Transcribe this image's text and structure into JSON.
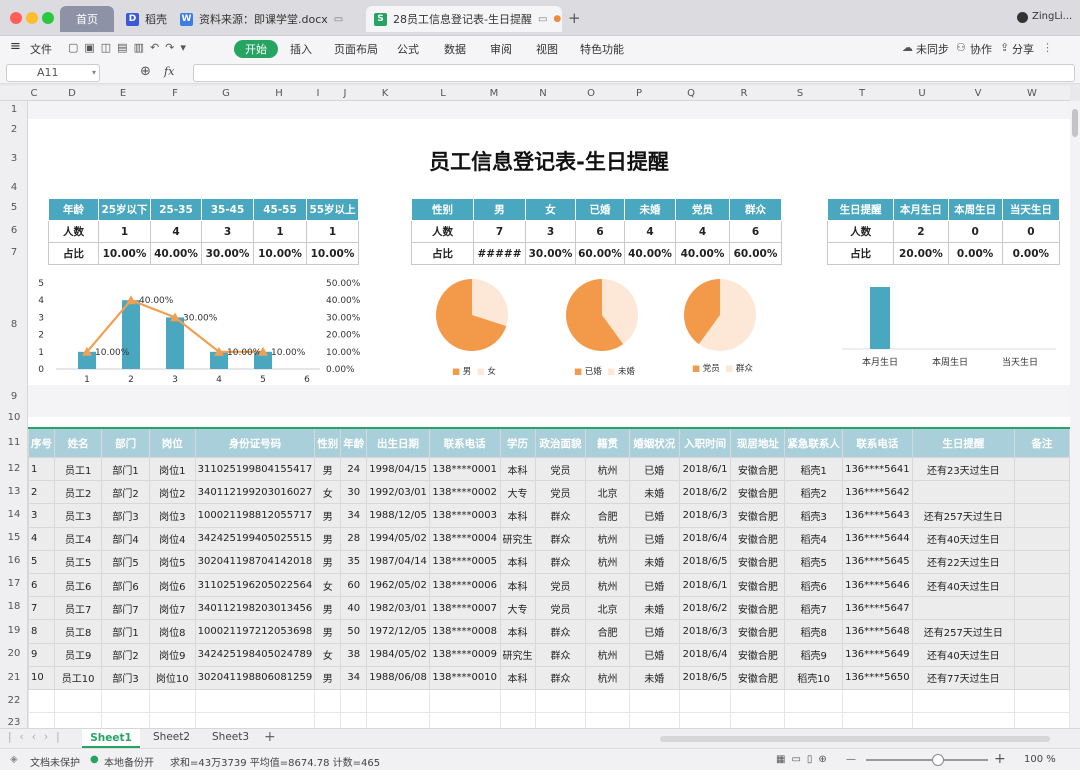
{
  "window": {
    "tabs": [
      {
        "label": "首页"
      },
      {
        "label": "稻壳",
        "icon": "daoke-icon"
      },
      {
        "label": "资料来源：即课学堂.docx",
        "icon": "word-doc-icon"
      },
      {
        "label": "28员工信息登记表-生日提醒",
        "icon": "sheet-doc-icon"
      }
    ],
    "user": "ZingLi..."
  },
  "toolbar": {
    "file": "文件",
    "menus": [
      "开始",
      "插入",
      "页面布局",
      "公式",
      "数据",
      "审阅",
      "视图",
      "特色功能"
    ],
    "sync": "未同步",
    "collab": "协作",
    "share": "分享"
  },
  "formula": {
    "cell_ref": "A11",
    "fx": "fx",
    "value": ""
  },
  "columns": [
    "C",
    "D",
    "E",
    "F",
    "G",
    "H",
    "I",
    "J",
    "K",
    "L",
    "M",
    "N",
    "O",
    "P",
    "Q",
    "R",
    "S",
    "T",
    "U",
    "V",
    "W"
  ],
  "rows": [
    "1",
    "2",
    "3",
    "4",
    "5",
    "6",
    "7",
    "8",
    "9",
    "10",
    "11",
    "12",
    "13",
    "14",
    "15",
    "16",
    "17",
    "18",
    "19",
    "20",
    "21",
    "22",
    "23"
  ],
  "sheet": {
    "title": "员工信息登记表-生日提醒",
    "age": {
      "headers": [
        "年龄",
        "25岁以下",
        "25-35",
        "35-45",
        "45-55",
        "55岁以上"
      ],
      "count": [
        "人数",
        "1",
        "4",
        "3",
        "1",
        "1"
      ],
      "ratio": [
        "占比",
        "10.00%",
        "40.00%",
        "30.00%",
        "10.00%",
        "10.00%"
      ]
    },
    "gender": {
      "headers": [
        "性别",
        "男",
        "女",
        "已婚",
        "未婚",
        "党员",
        "群众"
      ],
      "count": [
        "人数",
        "7",
        "3",
        "6",
        "4",
        "4",
        "6"
      ],
      "ratio": [
        "占比",
        "#####",
        "30.00%",
        "60.00%",
        "40.00%",
        "40.00%",
        "60.00%"
      ]
    },
    "birthday": {
      "headers": [
        "生日提醒",
        "本月生日",
        "本周生日",
        "当天生日"
      ],
      "count": [
        "人数",
        "2",
        "0",
        "0"
      ],
      "ratio": [
        "占比",
        "20.00%",
        "0.00%",
        "0.00%"
      ]
    },
    "employees": {
      "headers": [
        "序号",
        "姓名",
        "部门",
        "岗位",
        "身份证号码",
        "性别",
        "年龄",
        "出生日期",
        "联系电话",
        "学历",
        "政治面貌",
        "籍贯",
        "婚姻状况",
        "入职时间",
        "现居地址",
        "紧急联系人",
        "联系电话",
        "生日提醒",
        "备注"
      ],
      "rows": [
        [
          "1",
          "员工1",
          "部门1",
          "岗位1",
          "311025199804155417",
          "男",
          "24",
          "1998/04/15",
          "138****0001",
          "本科",
          "党员",
          "杭州",
          "已婚",
          "2018/6/1",
          "安徽合肥",
          "稻壳1",
          "136****5641",
          "还有23天过生日",
          ""
        ],
        [
          "2",
          "员工2",
          "部门2",
          "岗位2",
          "340112199203016027",
          "女",
          "30",
          "1992/03/01",
          "138****0002",
          "大专",
          "党员",
          "北京",
          "未婚",
          "2018/6/2",
          "安徽合肥",
          "稻壳2",
          "136****5642",
          "",
          ""
        ],
        [
          "3",
          "员工3",
          "部门3",
          "岗位3",
          "100021198812055717",
          "男",
          "34",
          "1988/12/05",
          "138****0003",
          "本科",
          "群众",
          "合肥",
          "已婚",
          "2018/6/3",
          "安徽合肥",
          "稻壳3",
          "136****5643",
          "还有257天过生日",
          ""
        ],
        [
          "4",
          "员工4",
          "部门4",
          "岗位4",
          "342425199405025515",
          "男",
          "28",
          "1994/05/02",
          "138****0004",
          "研究生",
          "群众",
          "杭州",
          "已婚",
          "2018/6/4",
          "安徽合肥",
          "稻壳4",
          "136****5644",
          "还有40天过生日",
          ""
        ],
        [
          "5",
          "员工5",
          "部门5",
          "岗位5",
          "302041198704142018",
          "男",
          "35",
          "1987/04/14",
          "138****0005",
          "本科",
          "群众",
          "杭州",
          "未婚",
          "2018/6/5",
          "安徽合肥",
          "稻壳5",
          "136****5645",
          "还有22天过生日",
          ""
        ],
        [
          "6",
          "员工6",
          "部门6",
          "岗位6",
          "311025196205022564",
          "女",
          "60",
          "1962/05/02",
          "138****0006",
          "本科",
          "党员",
          "杭州",
          "已婚",
          "2018/6/1",
          "安徽合肥",
          "稻壳6",
          "136****5646",
          "还有40天过生日",
          ""
        ],
        [
          "7",
          "员工7",
          "部门7",
          "岗位7",
          "340112198203013456",
          "男",
          "40",
          "1982/03/01",
          "138****0007",
          "大专",
          "党员",
          "北京",
          "未婚",
          "2018/6/2",
          "安徽合肥",
          "稻壳7",
          "136****5647",
          "",
          ""
        ],
        [
          "8",
          "员工8",
          "部门1",
          "岗位8",
          "100021197212053698",
          "男",
          "50",
          "1972/12/05",
          "138****0008",
          "本科",
          "群众",
          "合肥",
          "已婚",
          "2018/6/3",
          "安徽合肥",
          "稻壳8",
          "136****5648",
          "还有257天过生日",
          ""
        ],
        [
          "9",
          "员工9",
          "部门2",
          "岗位9",
          "342425198405024789",
          "女",
          "38",
          "1984/05/02",
          "138****0009",
          "研究生",
          "群众",
          "杭州",
          "已婚",
          "2018/6/4",
          "安徽合肥",
          "稻壳9",
          "136****5649",
          "还有40天过生日",
          ""
        ],
        [
          "10",
          "员工10",
          "部门3",
          "岗位10",
          "302041198806081259",
          "男",
          "34",
          "1988/06/08",
          "138****0010",
          "本科",
          "群众",
          "杭州",
          "未婚",
          "2018/6/5",
          "安徽合肥",
          "稻壳10",
          "136****5650",
          "还有77天过生日",
          ""
        ]
      ]
    }
  },
  "chart_data": [
    {
      "type": "bar",
      "categories": [
        "1",
        "2",
        "3",
        "4",
        "5",
        "6"
      ],
      "series": [
        {
          "values": [
            1,
            4,
            3,
            1,
            1
          ]
        },
        {
          "type": "line",
          "values": [
            10,
            40,
            30,
            10,
            10
          ],
          "labels": [
            "10.00%",
            "40.00%",
            "30.00%",
            "10.00%",
            "10.00%"
          ]
        }
      ],
      "ylim": [
        0,
        5
      ],
      "y_ticks": [
        "0",
        "1",
        "2",
        "3",
        "4",
        "5"
      ],
      "y2lim": [
        0,
        50
      ],
      "y2_ticks": [
        "0.00%",
        "10.00%",
        "20.00%",
        "30.00%",
        "40.00%",
        "50.00%"
      ],
      "colors": {
        "bar": "#4aa7c0",
        "line": "#f0a050"
      }
    },
    {
      "type": "pie",
      "labels": [
        "男",
        "女"
      ],
      "values": [
        7,
        3
      ],
      "colors": [
        "#f39a4a",
        "#fde8d7"
      ]
    },
    {
      "type": "pie",
      "labels": [
        "已婚",
        "未婚"
      ],
      "values": [
        6,
        4
      ],
      "colors": [
        "#f39a4a",
        "#fde8d7"
      ]
    },
    {
      "type": "pie",
      "labels": [
        "党员",
        "群众"
      ],
      "values": [
        4,
        6
      ],
      "colors": [
        "#f39a4a",
        "#fde8d7"
      ]
    },
    {
      "type": "bar",
      "categories": [
        "本月生日",
        "本周生日",
        "当天生日"
      ],
      "values": [
        2,
        0,
        0
      ],
      "colors": {
        "bar": "#4aa7c0"
      }
    }
  ],
  "sheet_tabs": [
    "Sheet1",
    "Sheet2",
    "Sheet3"
  ],
  "status": {
    "protect": "文档未保护",
    "backup": "本地备份开",
    "stats": "求和=43万3739  平均值=8674.78  计数=465",
    "zoom": "100 %"
  }
}
